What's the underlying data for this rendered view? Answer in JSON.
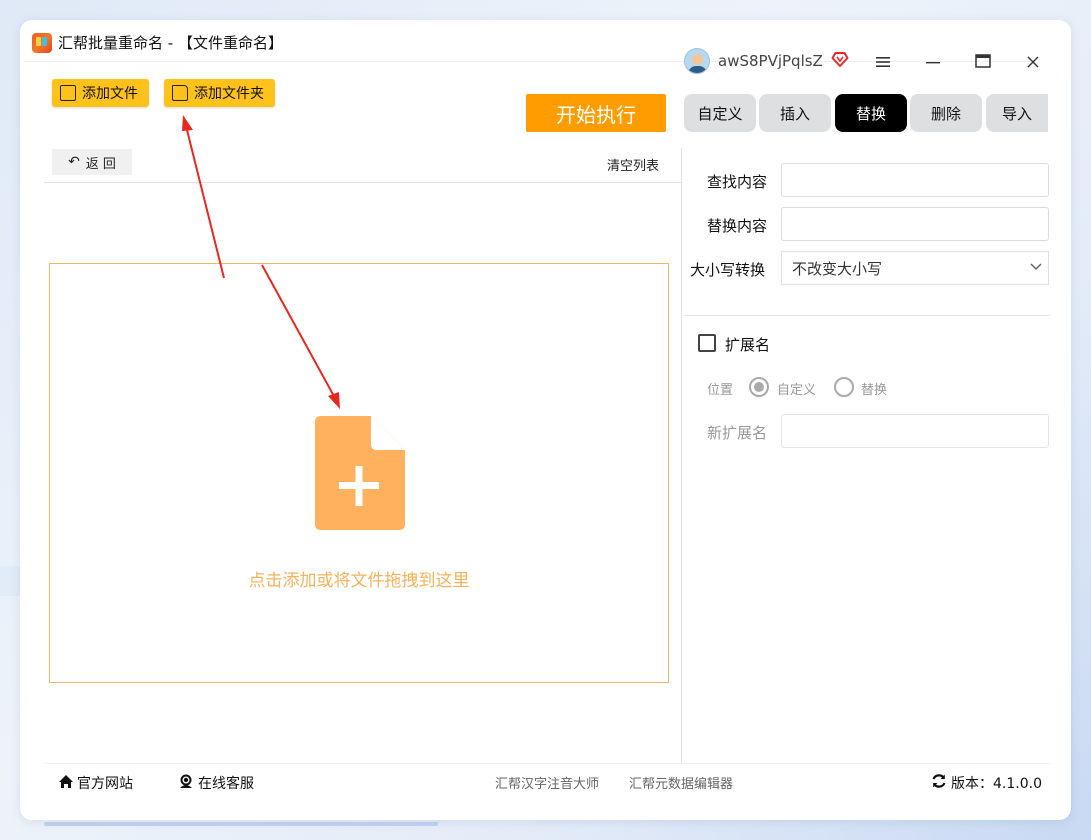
{
  "window": {
    "title": "汇帮批量重命名 - 【文件重命名】",
    "username": "awS8PVjPqlsZ",
    "controls": [
      "menu-icon",
      "minimize-icon",
      "maximize-icon",
      "close-icon"
    ]
  },
  "toolbar": {
    "add_file_label": "添加文件",
    "add_folder_label": "添加文件夹",
    "start_label": "开始执行"
  },
  "tabs": [
    {
      "label": "自定义",
      "active": false
    },
    {
      "label": "插入",
      "active": false
    },
    {
      "label": "替换",
      "active": true
    },
    {
      "label": "删除",
      "active": false
    },
    {
      "label": "导入",
      "active": false
    }
  ],
  "list": {
    "back_label": "返  回",
    "clear_label": "清空列表",
    "drop_text": "点击添加或将文件拖拽到这里"
  },
  "replace": {
    "find_label": "查找内容",
    "find_value": "",
    "replace_label": "替换内容",
    "replace_value": "",
    "case_label": "大小写转换",
    "case_value": "不改变大小写"
  },
  "extension": {
    "label": "扩展名",
    "checked": false,
    "position_label": "位置",
    "option_custom": "自定义",
    "option_replace": "替换",
    "selected": "自定义",
    "new_ext_label": "新扩展名",
    "new_ext_value": ""
  },
  "footer": {
    "website_label": "官方网站",
    "support_label": "在线客服",
    "link1": "汇帮汉字注音大师",
    "link2": "汇帮元数据编辑器",
    "version_label": "版本：4.1.0.0"
  },
  "colors": {
    "accent_yellow": "#ffc21a",
    "start_orange": "#ff9c00",
    "drop_border": "#f0b766",
    "drop_text": "#f6b25b",
    "file_icon": "#ffb15e",
    "arrow_red": "#e8281e"
  }
}
